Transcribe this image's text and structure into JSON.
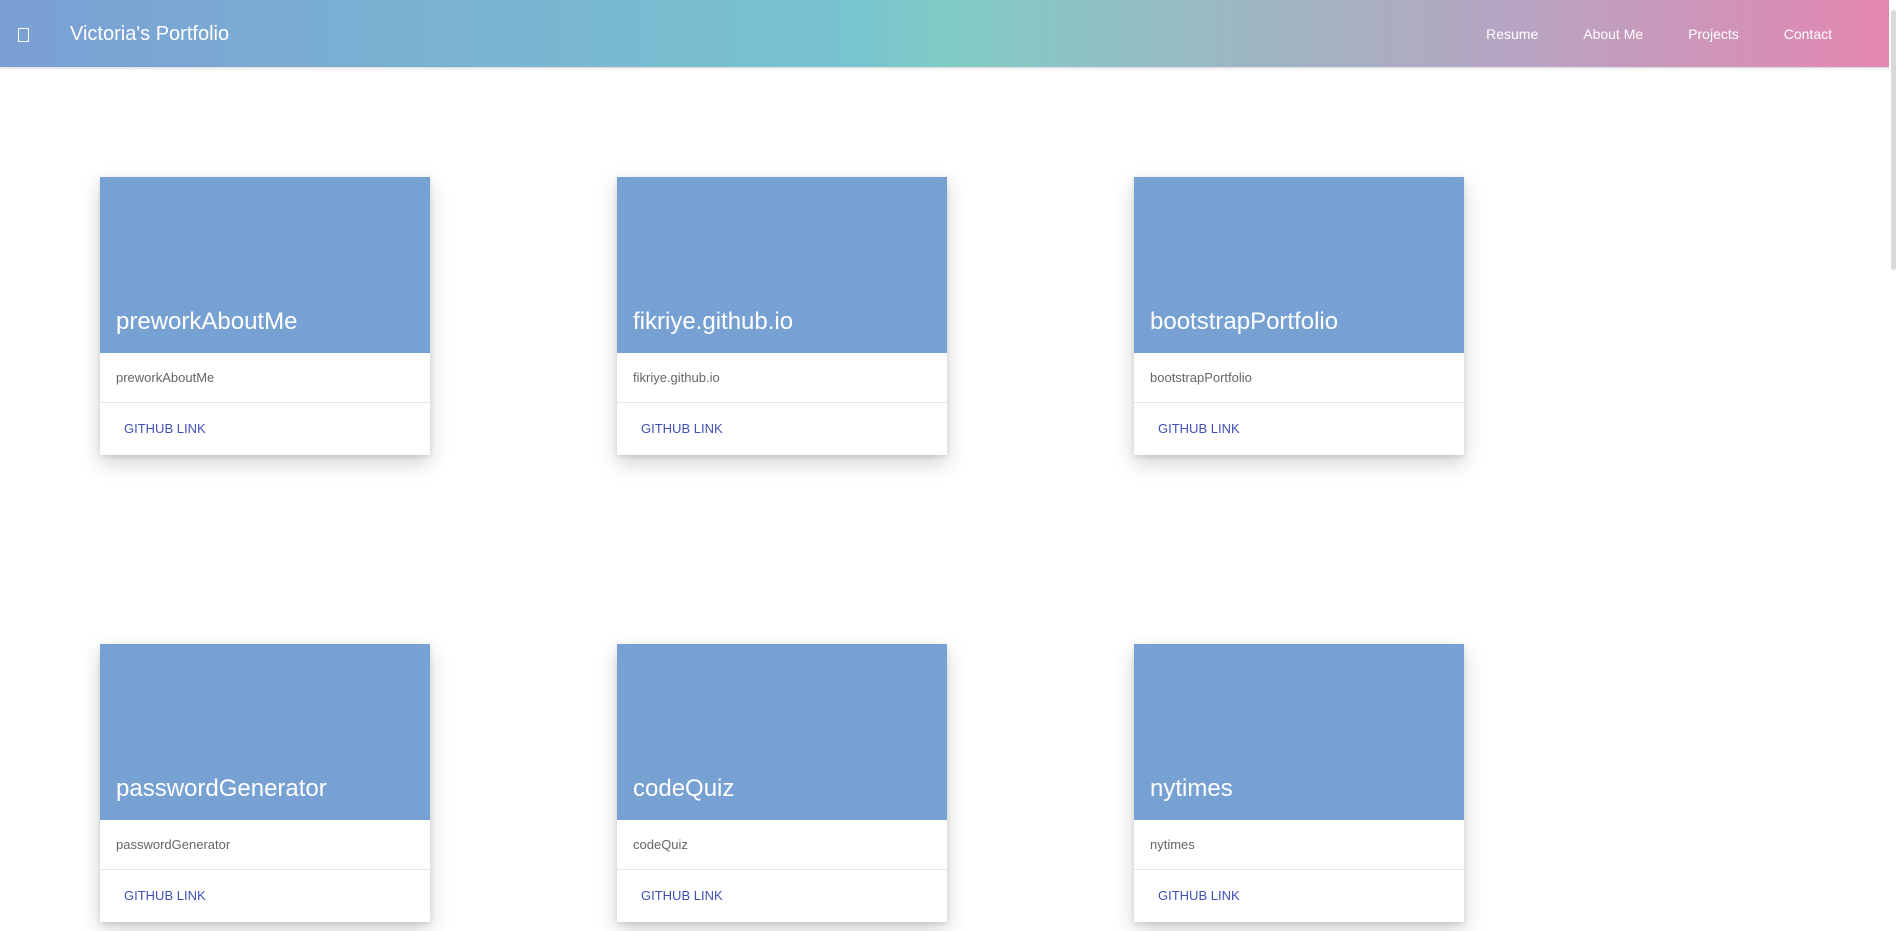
{
  "header": {
    "menu_icon": "menu-icon",
    "title": "Victoria's Portfolio",
    "nav": [
      {
        "label": "Resume"
      },
      {
        "label": "About Me"
      },
      {
        "label": "Projects"
      },
      {
        "label": "Contact"
      }
    ],
    "gradient_colors": [
      "#7b9fd4",
      "#78c4cf",
      "#80cbc4",
      "#b7a4c2",
      "#e586b0"
    ]
  },
  "cards": [
    {
      "title": "preworkAboutMe",
      "description": "preworkAboutMe",
      "action": "GITHUB LINK"
    },
    {
      "title": "fikriye.github.io",
      "description": "fikriye.github.io",
      "action": "GITHUB LINK"
    },
    {
      "title": "bootstrapPortfolio",
      "description": "bootstrapPortfolio",
      "action": "GITHUB LINK"
    },
    {
      "title": "passwordGenerator",
      "description": "passwordGenerator",
      "action": "GITHUB LINK"
    },
    {
      "title": "codeQuiz",
      "description": "codeQuiz",
      "action": "GITHUB LINK"
    },
    {
      "title": "nytimes",
      "description": "nytimes",
      "action": "GITHUB LINK"
    }
  ],
  "colors": {
    "card_image": "#77a0d3",
    "link": "#3f51b5"
  }
}
